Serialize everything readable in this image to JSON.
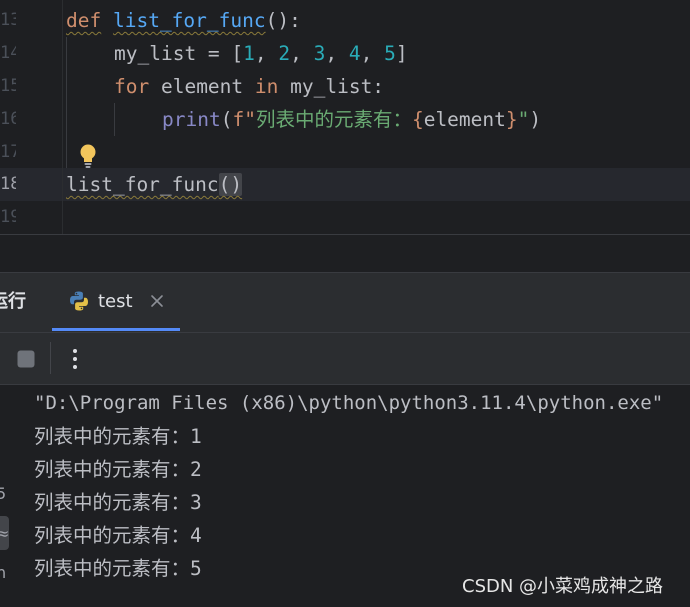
{
  "editor": {
    "line_numbers": [
      "13",
      "14",
      "15",
      "16",
      "17",
      "18",
      "19"
    ],
    "current_line": "18",
    "code": {
      "l13": {
        "kw": "def",
        "fn": "list_for_func",
        "rest": "():"
      },
      "l14": {
        "prefix": "my_list = [",
        "n1": "1",
        "n2": "2",
        "n3": "3",
        "n4": "4",
        "n5": "5",
        "sep": ", ",
        "suffix": "]"
      },
      "l15": {
        "kw_for": "for",
        "var": " element ",
        "kw_in": "in",
        "rest": " my_list:"
      },
      "l16": {
        "fn": "print",
        "open": "(",
        "fprefix": "f\"",
        "text": "列表中的元素有：",
        "brace_open": "{",
        "expr": "element",
        "brace_close": "}",
        "close_quote": "\"",
        "close": ")"
      },
      "l18": {
        "call": "list_for_func",
        "parens": "()"
      }
    },
    "intention_icon": "lightbulb-icon"
  },
  "run_window": {
    "title": "运行",
    "tab": {
      "label": "test",
      "icon": "python-icon",
      "close_icon": "close-icon"
    },
    "toolbar": {
      "stop_icon": "stop-icon",
      "more_icon": "more-vertical-icon"
    },
    "side_glyphs": [
      "5",
      "≈",
      "n"
    ],
    "output": [
      "\"D:\\Program Files (x86)\\python\\python3.11.4\\python.exe\"",
      "列表中的元素有：1",
      "列表中的元素有：2",
      "列表中的元素有：3",
      "列表中的元素有：4",
      "列表中的元素有：5"
    ]
  },
  "watermark": "CSDN @小菜鸡成神之路",
  "colors": {
    "background": "#1e1f22",
    "keyword": "#cf8e6d",
    "function": "#56a8f5",
    "number": "#2aacb8",
    "string": "#6aab73",
    "builtin": "#8888c6",
    "tab_accent": "#548af7"
  }
}
